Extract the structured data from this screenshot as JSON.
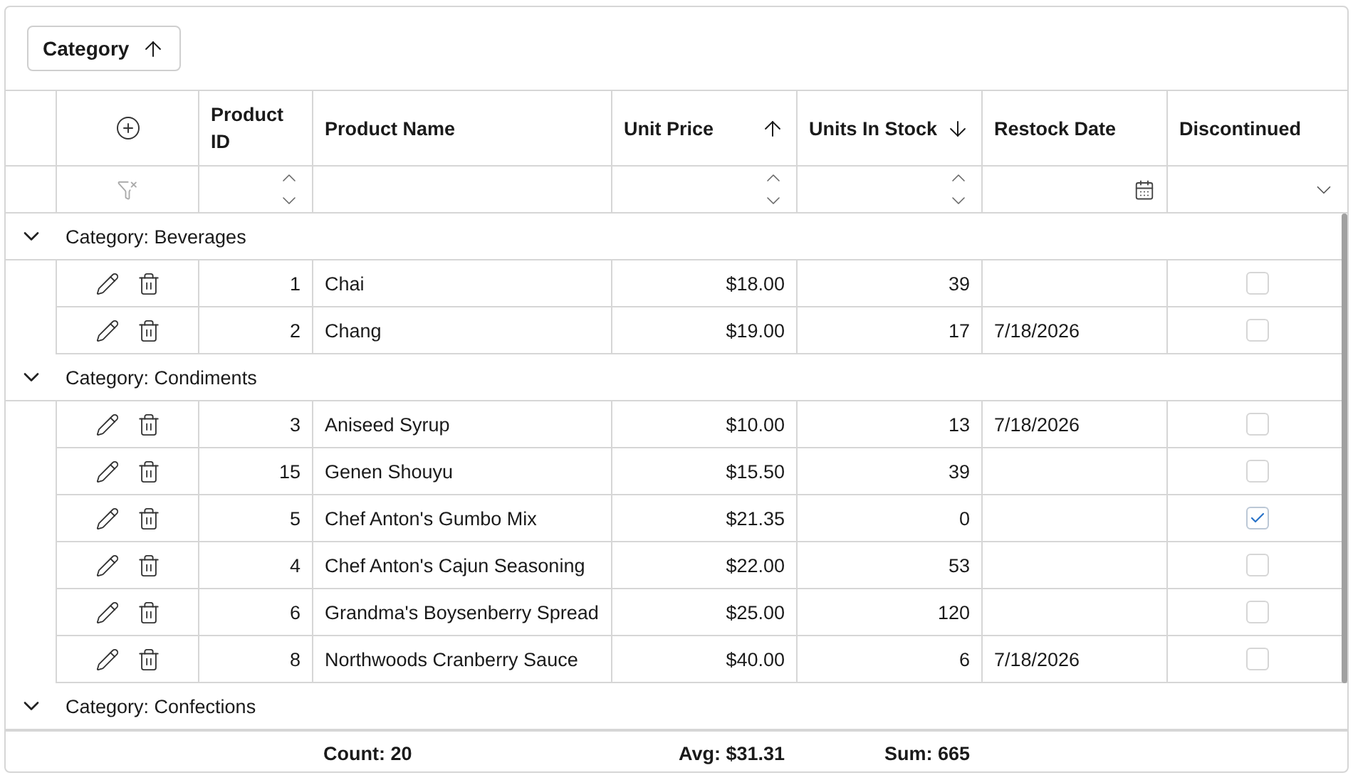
{
  "group_panel": {
    "chips": [
      {
        "label": "Category",
        "sort_ascending": true,
        "sort_descending": false
      }
    ]
  },
  "columns": [
    {
      "label": "Product ID",
      "sort_ascending": false,
      "sort_descending": false,
      "kind": "numeric"
    },
    {
      "label": "Product Name",
      "sort_ascending": false,
      "sort_descending": false,
      "kind": "text"
    },
    {
      "label": "Unit Price",
      "sort_ascending": true,
      "sort_descending": false,
      "kind": "numeric"
    },
    {
      "label": "Units In Stock",
      "sort_ascending": false,
      "sort_descending": true,
      "kind": "numeric"
    },
    {
      "label": "Restock Date",
      "sort_ascending": false,
      "sort_descending": false,
      "kind": "date"
    },
    {
      "label": "Discontinued",
      "sort_ascending": false,
      "sort_descending": false,
      "kind": "boolean"
    }
  ],
  "groups": [
    {
      "label": "Category: Beverages",
      "expanded": true,
      "rows": [
        {
          "product_id": "1",
          "product_name": "Chai",
          "unit_price": "$18.00",
          "units_in_stock": "39",
          "discontinued": false
        },
        {
          "product_id": "2",
          "product_name": "Chang",
          "unit_price": "$19.00",
          "units_in_stock": "17",
          "restock_date": "7/18/2026",
          "discontinued": false
        }
      ]
    },
    {
      "label": "Category: Condiments",
      "expanded": true,
      "rows": [
        {
          "product_id": "3",
          "product_name": "Aniseed Syrup",
          "unit_price": "$10.00",
          "units_in_stock": "13",
          "restock_date": "7/18/2026",
          "discontinued": false
        },
        {
          "product_id": "15",
          "product_name": "Genen Shouyu",
          "unit_price": "$15.50",
          "units_in_stock": "39",
          "discontinued": false
        },
        {
          "product_id": "5",
          "product_name": "Chef Anton's Gumbo Mix",
          "unit_price": "$21.35",
          "units_in_stock": "0",
          "discontinued": true
        },
        {
          "product_id": "4",
          "product_name": "Chef Anton's Cajun Seasoning",
          "unit_price": "$22.00",
          "units_in_stock": "53",
          "discontinued": false
        },
        {
          "product_id": "6",
          "product_name": "Grandma's Boysenberry Spread",
          "unit_price": "$25.00",
          "units_in_stock": "120",
          "discontinued": false
        },
        {
          "product_id": "8",
          "product_name": "Northwoods Cranberry Sauce",
          "unit_price": "$40.00",
          "units_in_stock": "6",
          "restock_date": "7/18/2026",
          "discontinued": false
        }
      ]
    },
    {
      "label": "Category: Confections",
      "expanded": true
    }
  ],
  "footer": {
    "count": "Count: 20",
    "average": "Avg: $31.31",
    "sum": "Sum: 665"
  }
}
